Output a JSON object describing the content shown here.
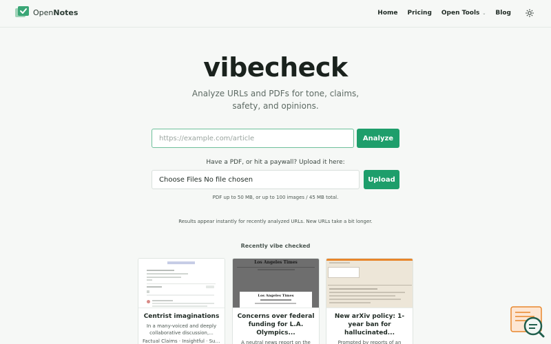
{
  "header": {
    "logo_light": "Open",
    "logo_bold": "Notes",
    "nav": {
      "home": "Home",
      "pricing": "Pricing",
      "open_tools": "Open Tools",
      "blog": "Blog"
    }
  },
  "hero": {
    "title": "vibecheck",
    "subtitle": "Analyze URLs and PDFs for tone, claims, safety, and opinions."
  },
  "url_form": {
    "placeholder": "https://example.com/article",
    "analyze_label": "Analyze"
  },
  "upload": {
    "label": "Have a PDF, or hit a paywall? Upload it here:",
    "file_button": "Choose Files",
    "file_status": "No file chosen",
    "upload_label": "Upload",
    "limits": "PDF up to 50 MB, or up to 100 images / 45 MB total."
  },
  "results_note": "Results appear instantly for recently analyzed URLs. New URLs take a bit longer.",
  "recent": {
    "heading": "Recently vibe checked",
    "cards": [
      {
        "title": "Centrist imaginations",
        "description": "In a many-voiced and deeply collaborative discussion,...",
        "tags": "Factual Claims · Insightful · Supp..."
      },
      {
        "title": "Concerns over federal funding for L.A. Olympics...",
        "description": "A neutral news report on the political and financial...",
        "masthead": "Los Angeles Times",
        "banner": "Los Angeles Times"
      },
      {
        "title": "New arXiv policy: 1-year ban for hallucinated...",
        "description": "Prompted by reports of an arXiv policy penalizing hallucinated..."
      }
    ]
  },
  "colors": {
    "accent": "#1e9e6b",
    "input_border": "#6dbf9a",
    "background": "#f6f8f6"
  }
}
